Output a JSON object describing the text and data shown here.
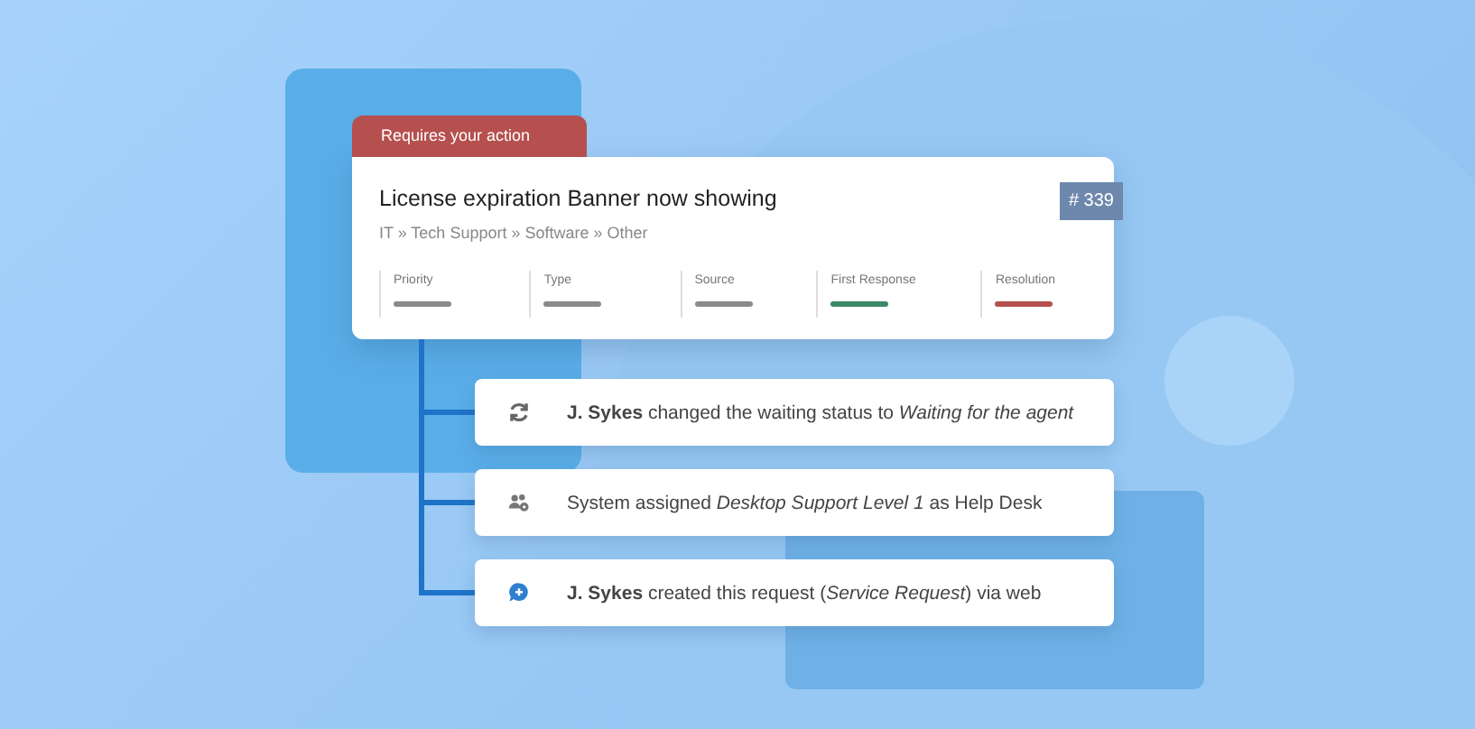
{
  "ticket": {
    "action_badge": "Requires your action",
    "title": "License expiration Banner now showing",
    "breadcrumb": "IT » Tech Support » Software » Other",
    "number": "# 339",
    "fields": [
      {
        "label": "Priority",
        "color": "#8a8a8a"
      },
      {
        "label": "Type",
        "color": "#8a8a8a"
      },
      {
        "label": "Source",
        "color": "#8a8a8a"
      },
      {
        "label": "First Response",
        "color": "#3a8a66"
      },
      {
        "label": "Resolution",
        "color": "#b5504e"
      }
    ]
  },
  "events": [
    {
      "kind": "refresh",
      "text": "**J. Sykes** changed the waiting status to *Waiting for the agent*"
    },
    {
      "kind": "group",
      "text": "System assigned *Desktop Support Level 1* as Help Desk"
    },
    {
      "kind": "comment",
      "text": "**J. Sykes** created this request (*Service Request*) via web"
    }
  ]
}
